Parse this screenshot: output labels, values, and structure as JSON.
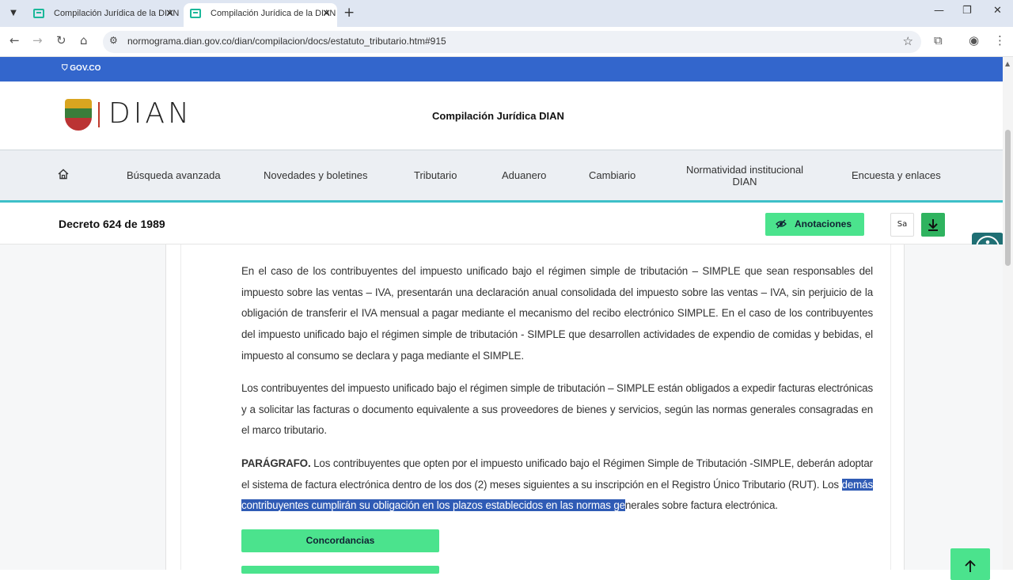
{
  "browser": {
    "tabs": [
      {
        "title": "Compilación Jurídica de la DIAN"
      },
      {
        "title": "Compilación Jurídica de la DIAN"
      }
    ],
    "url": "normograma.dian.gov.co/dian/compilacion/docs/estatuto_tributario.htm#915"
  },
  "govbar": {
    "label": "GOV.CO"
  },
  "header": {
    "logo_text": "DIAN",
    "site_title": "Compilación Jurídica DIAN"
  },
  "nav": {
    "items": [
      {
        "label": "Búsqueda avanzada"
      },
      {
        "label": "Novedades y boletines"
      },
      {
        "label": "Tributario"
      },
      {
        "label": "Aduanero"
      },
      {
        "label": "Cambiario"
      },
      {
        "label": "Normatividad institucional DIAN"
      },
      {
        "label": "Encuesta y enlaces"
      }
    ]
  },
  "docbar": {
    "title": "Decreto 624 de 1989",
    "annotations_label": "Anotaciones",
    "signature_label": "Sa"
  },
  "content": {
    "p1": "En el caso de los contribuyentes del impuesto unificado bajo el régimen simple de tributación – SIMPLE que sean responsables del impuesto sobre las ventas – IVA, presentarán una declaración anual consolidada del impuesto sobre las ventas – IVA, sin perjuicio de la obligación de transferir el IVA mensual a pagar mediante el mecanismo del recibo electrónico SIMPLE. En el caso de los contribuyentes del impuesto unificado bajo el régimen simple de tributación - SIMPLE que desarrollen actividades de expendio de comidas y bebidas, el impuesto al consumo se declara y paga mediante el SIMPLE.",
    "p2": "Los contribuyentes del impuesto unificado bajo el régimen simple de tributación – SIMPLE están obligados a expedir facturas electrónicas y a solicitar las facturas o documento equivalente a sus proveedores de bienes y servicios, según las normas generales consagradas en el marco tributario.",
    "p3_bold": "PARÁGRAFO.",
    "p3_text": " Los contribuyentes que opten por el impuesto unificado bajo el Régimen Simple de Tributación -SIMPLE, deberán adoptar el sistema de factura electrónica dentro de los dos (2) meses siguientes a su inscripción en el Registro Único Tributario (RUT). Los ",
    "p3_highlight": "demás contribuyentes cumplirán su obligación en los plazos establecidos en las normas ge",
    "p3_tail": "nerales sobre factura electrónica.",
    "concordancias_label": "Concordancias"
  },
  "colors": {
    "gov_blue": "#3366cc",
    "accent_green": "#4be38d",
    "nav_underline": "#3ec0c8",
    "selection": "#2f5bb5"
  }
}
